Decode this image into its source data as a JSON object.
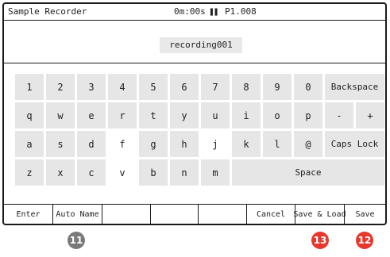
{
  "status": {
    "app_name": "Sample Recorder",
    "time": "0m:00s",
    "pause_icon": "pause-icon",
    "position": "P1.008"
  },
  "name_field": {
    "value": "recording001"
  },
  "keyboard": {
    "row1": [
      "1",
      "2",
      "3",
      "4",
      "5",
      "6",
      "7",
      "8",
      "9",
      "0"
    ],
    "row1_extra": "Backspace",
    "row2": [
      "q",
      "w",
      "e",
      "r",
      "t",
      "y",
      "u",
      "i",
      "o",
      "p"
    ],
    "row2_minus": "-",
    "row2_plus": "+",
    "row3": [
      "a",
      "s",
      "d",
      "f",
      "g",
      "h",
      "j",
      "k",
      "l",
      "@"
    ],
    "row3_extra": "Caps Lock",
    "row4": [
      "z",
      "x",
      "c",
      "v",
      "b",
      "n",
      "m"
    ],
    "row4_space": "Space",
    "selected_keys": [
      "f",
      "j",
      "v"
    ]
  },
  "softkeys": [
    "Enter",
    "Auto Name",
    "",
    "",
    "",
    "Cancel",
    "Save & Load",
    "Save"
  ],
  "callouts": [
    {
      "label": "11",
      "color": "#7a7a7a"
    },
    {
      "label": "13",
      "color": "#e8372d"
    },
    {
      "label": "12",
      "color": "#e8372d"
    }
  ]
}
